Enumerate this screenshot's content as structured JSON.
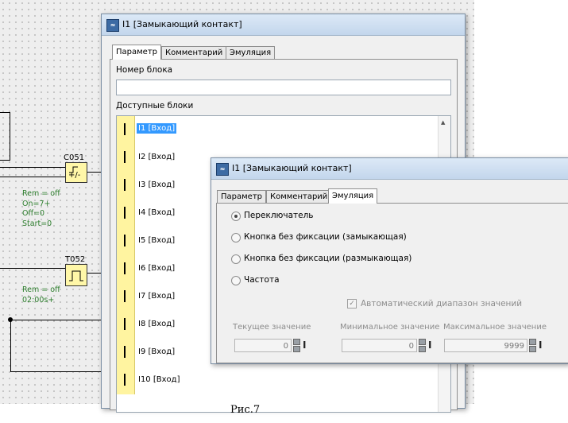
{
  "caption": "Рис.7",
  "diagram": {
    "blocks": [
      {
        "id": "C051",
        "symbol": "+/-",
        "params": "Rem = off\nOn=7+\nOff=0\nStart=0"
      },
      {
        "id": "T052",
        "symbol": "",
        "params": "Rem = off\n02:00s+"
      }
    ]
  },
  "window_back": {
    "title": "I1 [Замыкающий контакт]",
    "tabs": [
      "Параметр",
      "Комментарий",
      "Эмуляция"
    ],
    "active_tab": 0,
    "block_number_label": "Номер блока",
    "block_number_value": "",
    "available_blocks_label": "Доступные блоки",
    "available_blocks": [
      "I1 [Вход]",
      "I2 [Вход]",
      "I3 [Вход]",
      "I4 [Вход]",
      "I5 [Вход]",
      "I6 [Вход]",
      "I7 [Вход]",
      "I8 [Вход]",
      "I9 [Вход]",
      "I10 [Вход]"
    ],
    "selected_index": 0,
    "icon_glyph": "I"
  },
  "window_front": {
    "title": "I1 [Замыкающий контакт]",
    "tabs": [
      "Параметр",
      "Комментарий",
      "Эмуляция"
    ],
    "active_tab": 2,
    "options": [
      "Переключатель",
      "Кнопка без фиксации (замыкающая)",
      "Кнопка без фиксации (размыкающая)",
      "Частота"
    ],
    "selected_option": 0,
    "auto_range_label": "Автоматический диапазон значений",
    "auto_range_checked": true,
    "fields": [
      {
        "label": "Текущее значение",
        "value": "0"
      },
      {
        "label": "Минимальное значение",
        "value": "0"
      },
      {
        "label": "Максимальное значение",
        "value": "9999"
      }
    ]
  },
  "colors": {
    "selection": "#3399ff",
    "block_fill": "#fff7a8",
    "param_text": "#2c7d2c"
  }
}
